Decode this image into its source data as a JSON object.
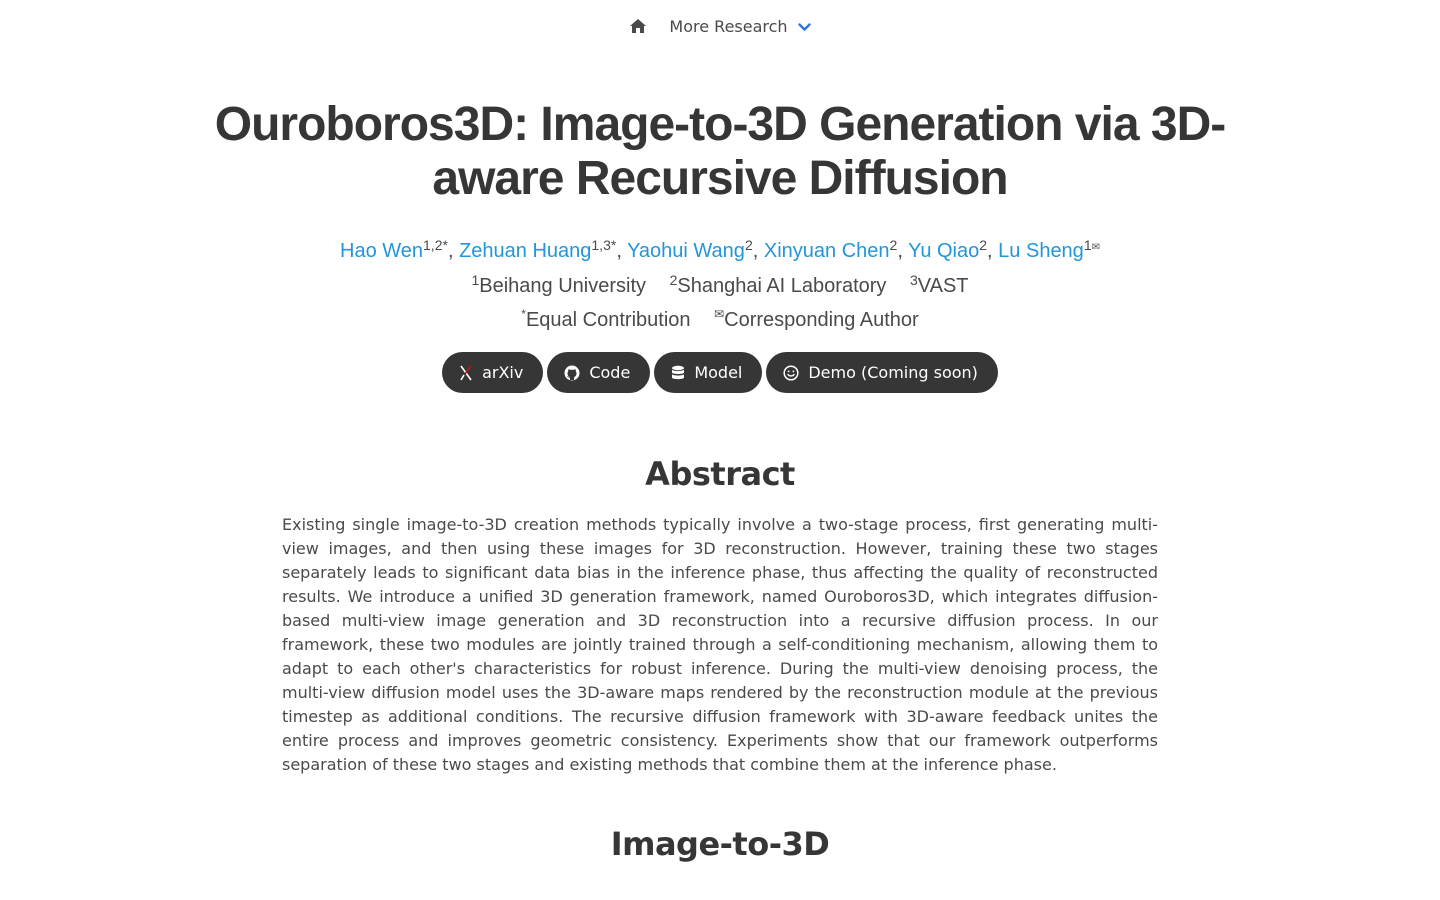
{
  "nav": {
    "more_research": "More Research"
  },
  "title": "Ouroboros3D: Image-to-3D Generation via 3D-aware Recursive Diffusion",
  "authors": [
    {
      "name": "Hao Wen",
      "sup": "1,2*",
      "sep": ", "
    },
    {
      "name": "Zehuan Huang",
      "sup": "1,3*",
      "sep": ", "
    },
    {
      "name": "Yaohui Wang",
      "sup": "2",
      "sep": ", "
    },
    {
      "name": "Xinyuan Chen",
      "sup": "2",
      "sep": ", "
    },
    {
      "name": "Yu Qiao",
      "sup": "2",
      "sep": ", "
    },
    {
      "name": "Lu Sheng",
      "sup": "1",
      "sep": ""
    }
  ],
  "affiliations": [
    {
      "sup": "1",
      "name": "Beihang University"
    },
    {
      "sup": "2",
      "name": "Shanghai AI Laboratory"
    },
    {
      "sup": "3",
      "name": "VAST"
    }
  ],
  "notes": {
    "equal_sup": "*",
    "equal": "Equal Contribution",
    "corr_sup": "✉",
    "corr": "Corresponding Author"
  },
  "buttons": {
    "arxiv": "arXiv",
    "code": "Code",
    "model": "Model",
    "demo": "Demo (Coming soon)"
  },
  "abstract": {
    "heading": "Abstract",
    "text": "Existing single image-to-3D creation methods typically involve a two-stage process, first generating multi-view images, and then using these images for 3D reconstruction. However, training these two stages separately leads to significant data bias in the inference phase, thus affecting the quality of reconstructed results. We introduce a unified 3D generation framework, named Ouroboros3D, which integrates diffusion-based multi-view image generation and 3D reconstruction into a recursive diffusion process. In our framework, these two modules are jointly trained through a self-conditioning mechanism, allowing them to adapt to each other's characteristics for robust inference. During the multi-view denoising process, the multi-view diffusion model uses the 3D-aware maps rendered by the reconstruction module at the previous timestep as additional conditions. The recursive diffusion framework with 3D-aware feedback unites the entire process and improves geometric consistency. Experiments show that our framework outperforms separation of these two stages and existing methods that combine them at the inference phase."
  },
  "section2": {
    "heading": "Image-to-3D"
  },
  "colors": {
    "link": "#2196d9",
    "button_bg": "#363636",
    "text": "#4a4a4a",
    "heading": "#363636"
  }
}
